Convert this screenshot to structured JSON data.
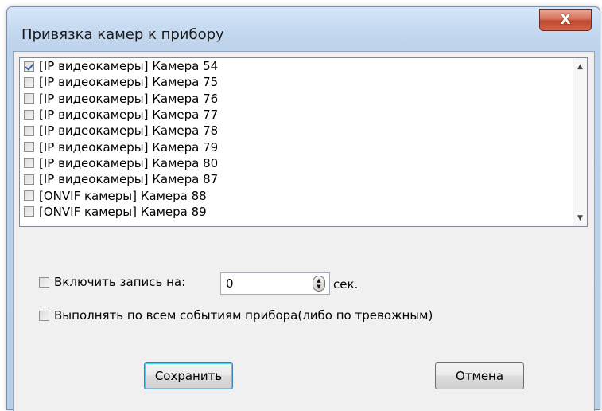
{
  "window": {
    "title": "Привязка камер к прибору",
    "close_label": "X"
  },
  "camera_list": {
    "items": [
      {
        "label": "[IP видеокамеры] Камера 54",
        "checked": true
      },
      {
        "label": "[IP видеокамеры] Камера 75",
        "checked": false
      },
      {
        "label": "[IP видеокамеры] Камера 76",
        "checked": false
      },
      {
        "label": "[IP видеокамеры] Камера 77",
        "checked": false
      },
      {
        "label": "[IP видеокамеры] Камера 78",
        "checked": false
      },
      {
        "label": "[IP видеокамеры] Камера 79",
        "checked": false
      },
      {
        "label": "[IP видеокамеры] Камера 80",
        "checked": false
      },
      {
        "label": "[IP видеокамеры] Камера 87",
        "checked": false
      },
      {
        "label": "[ONVIF камеры] Камера 88",
        "checked": false
      },
      {
        "label": "[ONVIF камеры] Камера 89",
        "checked": false
      }
    ]
  },
  "options": {
    "record_label": "Включить запись на:",
    "record_checked": false,
    "record_value": "0",
    "record_unit": "сек.",
    "all_events_label": "Выполнять по всем событиям прибора(либо по тревожным)",
    "all_events_checked": false
  },
  "buttons": {
    "save_label": "Сохранить",
    "cancel_label": "Отмена"
  }
}
